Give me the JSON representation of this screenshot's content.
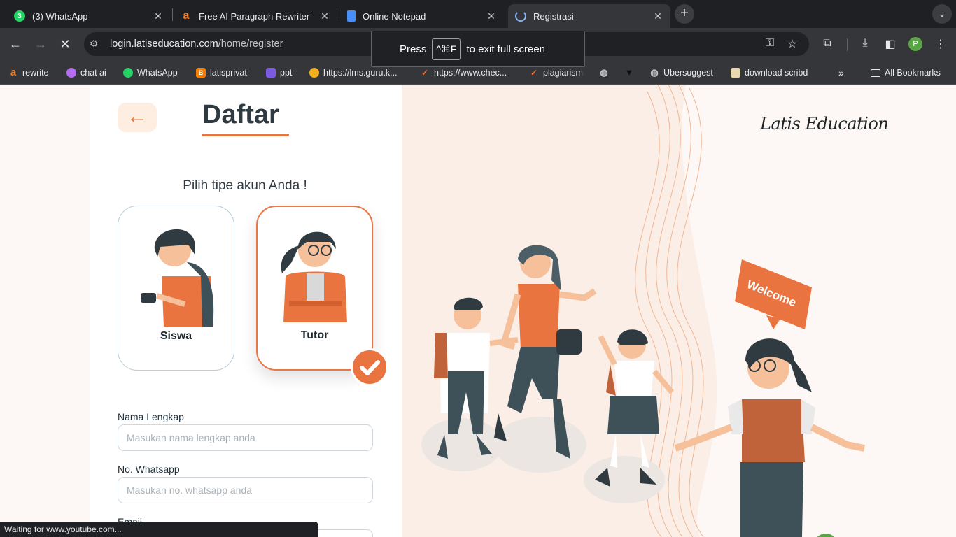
{
  "browser": {
    "tabs": [
      {
        "title": "(3) WhatsApp",
        "badge": "3",
        "icon": "whatsapp-icon",
        "color": "#25d366",
        "active": false
      },
      {
        "title": "Free AI Paragraph Rewriter",
        "icon": "rewriter-icon",
        "color": "#f47c20",
        "active": false
      },
      {
        "title": "Online Notepad",
        "icon": "document-icon",
        "color": "#4a8ff7",
        "active": false
      },
      {
        "title": "Registrasi",
        "icon": "site-loading-icon",
        "color": "#8ab4f8",
        "active": true
      }
    ],
    "url_host": "login.latiseducation.com",
    "url_path": "/home/register",
    "profile_initial": "P",
    "bookmarks": [
      {
        "label": "rewrite",
        "icon": "rewriter-icon"
      },
      {
        "label": "chat ai",
        "icon": "chat-ai-icon"
      },
      {
        "label": "WhatsApp",
        "icon": "whatsapp-icon"
      },
      {
        "label": "latisprivat",
        "icon": "blogger-icon"
      },
      {
        "label": "ppt",
        "icon": "ppt-icon"
      },
      {
        "label": "https://lms.guru.k...",
        "icon": "lms-icon"
      },
      {
        "label": "https://www.chec...",
        "icon": "checkmark-icon"
      },
      {
        "label": "plagiarism",
        "icon": "checkmark-icon"
      },
      {
        "label": "Ubersuggest",
        "icon": "globe-icon"
      },
      {
        "label": "download scribd",
        "icon": "scribd-icon"
      }
    ],
    "all_bookmarks": "All Bookmarks",
    "status_text": "Waiting for www.youtube.com..."
  },
  "toast": {
    "press": "Press",
    "key": "^⌘F",
    "suffix": "to exit full screen"
  },
  "page": {
    "title": "Daftar",
    "subtitle": "Pilih tipe akun Anda !",
    "account_types": [
      {
        "label": "Siswa",
        "selected": false
      },
      {
        "label": "Tutor",
        "selected": true
      }
    ],
    "form": {
      "name_label": "Nama Lengkap",
      "name_placeholder": "Masukan nama lengkap anda",
      "whatsapp_label": "No. Whatsapp",
      "whatsapp_placeholder": "Masukan no. whatsapp anda",
      "email_label": "Email"
    },
    "brand": "Latis Education",
    "welcome_sign": "Welcome"
  },
  "colors": {
    "accent": "#e9743f",
    "dark_text": "#2f3a41"
  }
}
